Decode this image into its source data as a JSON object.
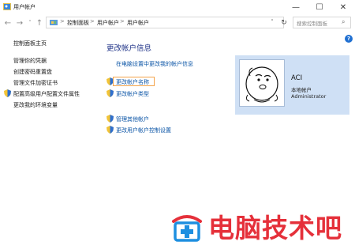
{
  "window": {
    "title": "用户帐户"
  },
  "addressbar": {
    "crumbs": [
      "控制面板",
      "用户帐户",
      "用户帐户"
    ],
    "separator": ">",
    "search_placeholder": "搜索控制面板"
  },
  "sidebar": {
    "items": [
      {
        "label": "控制面板主页",
        "icon": null
      },
      {
        "label": "管理你的凭据",
        "icon": null
      },
      {
        "label": "创建密码重置盘",
        "icon": null
      },
      {
        "label": "管理文件加密证书",
        "icon": null
      },
      {
        "label": "配置高级用户配置文件属性",
        "icon": "shield-icon"
      },
      {
        "label": "更改我的环境变量",
        "icon": null
      }
    ]
  },
  "main": {
    "heading": "更改帐户信息",
    "settings_link": "在电脑设置中更改我的帐户信息",
    "actions": [
      {
        "label": "更改帐户名称",
        "highlighted": true
      },
      {
        "label": "更改帐户类型",
        "highlighted": false
      }
    ],
    "other_actions": [
      {
        "label": "管理其他帐户"
      },
      {
        "label": "更改用户帐户控制设置"
      }
    ]
  },
  "account": {
    "name": "ACI",
    "type": "本地帐户",
    "role": "Administrator"
  },
  "watermark": {
    "text": "电脑技术吧"
  },
  "colors": {
    "link": "#0a54a6",
    "heading": "#1e3287",
    "highlight_border": "#f4a44b",
    "card_bg": "#cfe0f5",
    "watermark": "#e5303a"
  }
}
